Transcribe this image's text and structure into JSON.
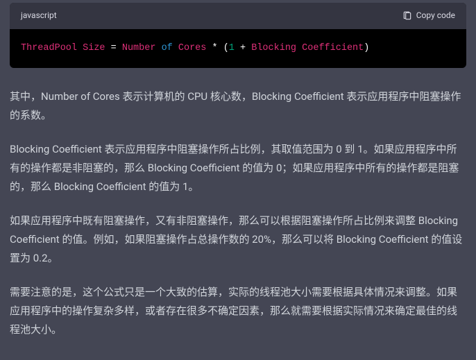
{
  "codeblock": {
    "language": "javascript",
    "copy_label": "Copy code",
    "tokens": {
      "t0": "ThreadPool",
      "t1": " ",
      "t2": "Size",
      "t3": " = ",
      "t4": "Number",
      "t5": " ",
      "t6": "of",
      "t7": " ",
      "t8": "Cores",
      "t9": " * (",
      "t10": "1",
      "t11": " + ",
      "t12": "Blocking",
      "t13": " ",
      "t14": "Coefficient",
      "t15": ")"
    }
  },
  "paragraphs": {
    "p1": "其中，Number of Cores 表示计算机的 CPU 核心数，Blocking Coefficient 表示应用程序中阻塞操作的系数。",
    "p2": "Blocking Coefficient 表示应用程序中阻塞操作所占比例，其取值范围为 0 到 1。如果应用程序中所有的操作都是非阻塞的，那么 Blocking Coefficient 的值为 0；如果应用程序中所有的操作都是阻塞的，那么 Blocking Coefficient 的值为 1。",
    "p3": "如果应用程序中既有阻塞操作，又有非阻塞操作，那么可以根据阻塞操作所占比例来调整 Blocking Coefficient 的值。例如，如果阻塞操作占总操作数的 20%，那么可以将 Blocking Coefficient 的值设置为 0.2。",
    "p4": "需要注意的是，这个公式只是一个大致的估算，实际的线程池大小需要根据具体情况来调整。如果应用程序中的操作复杂多样，或者存在很多不确定因素，那么就需要根据实际情况来确定最佳的线程池大小。"
  }
}
